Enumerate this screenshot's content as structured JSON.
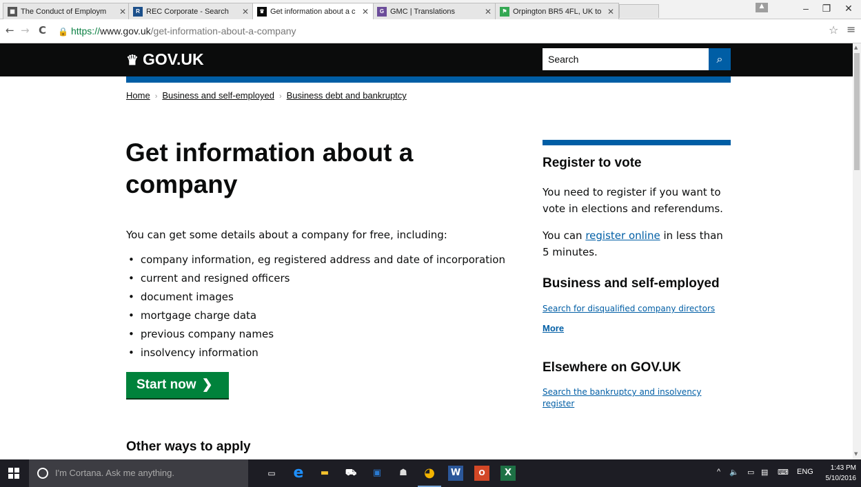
{
  "browser": {
    "tabs": [
      {
        "title": "The Conduct of Employm",
        "favicon": "doc-favicon",
        "color": "#555555"
      },
      {
        "title": "REC Corporate - Search",
        "favicon": "rec-favicon",
        "color": "#1b4f8a"
      },
      {
        "title": "Get information about a c",
        "favicon": "govuk-favicon",
        "color": "#0b0c0c"
      },
      {
        "title": "GMC | Translations",
        "favicon": "gmc-favicon",
        "color": "#6b4c9a"
      },
      {
        "title": "Orpington BR5 4FL, UK to",
        "favicon": "maps-favicon",
        "color": "#34a853"
      }
    ],
    "url_scheme": "https://",
    "url_host": "www.gov.uk",
    "url_path": "/get-information-about-a-company"
  },
  "header": {
    "logo": "GOV.UK",
    "search_placeholder": "Search"
  },
  "breadcrumb": [
    "Home",
    "Business and self-employed",
    "Business debt and bankruptcy"
  ],
  "main": {
    "title": "Get information about a company",
    "intro": "You can get some details about a company for free, including:",
    "bullets": [
      "company information, eg registered address and date of incorporation",
      "current and resigned officers",
      "document images",
      "mortgage charge data",
      "previous company names",
      "insolvency information"
    ],
    "start_button": "Start now",
    "other_ways_heading": "Other ways to apply"
  },
  "sidebar": {
    "register_heading": "Register to vote",
    "register_text": "You need to register if you want to vote in elections and referendums.",
    "register_online_prefix": "You can ",
    "register_online_link": "register online",
    "register_online_suffix": " in less than 5 minutes.",
    "business_heading": "Business and self-employed",
    "business_link": "Search for disqualified company directors",
    "more_link": "More",
    "elsewhere_heading": "Elsewhere on GOV.UK",
    "elsewhere_link": "Search the bankruptcy and insolvency register"
  },
  "taskbar": {
    "cortana_placeholder": "I'm Cortana. Ask me anything.",
    "language": "ENG",
    "time": "1:43 PM",
    "date": "5/10/2016"
  },
  "colors": {
    "govuk_black": "#0b0c0c",
    "govuk_blue": "#005ea5",
    "govuk_green": "#00823b"
  }
}
